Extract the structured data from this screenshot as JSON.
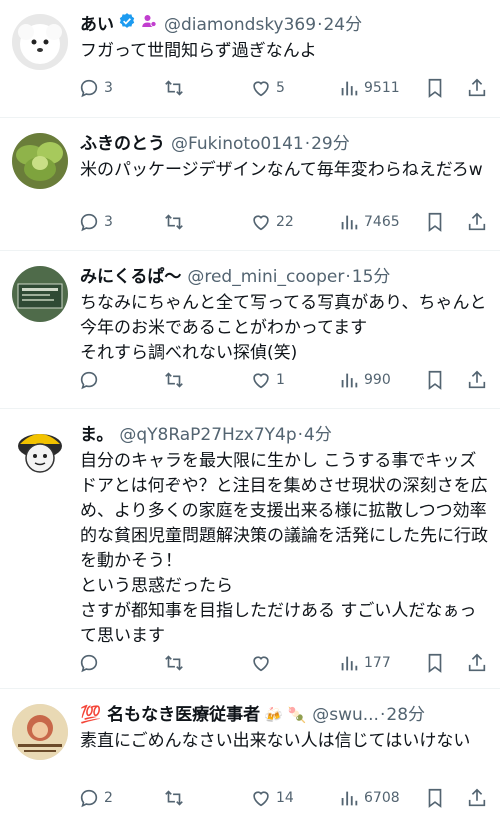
{
  "tweets": [
    {
      "name": "あい",
      "handle": "@diamondsky369",
      "time": "24分",
      "text": "フガって世間知らず過ぎなんよ",
      "replies": "3",
      "retweets": "",
      "likes": "5",
      "views": "9511",
      "avatar_icon": "white-dog-avatar",
      "badges": [
        "verified-check-icon",
        "affiliate-person-icon"
      ]
    },
    {
      "name": "ふきのとう",
      "handle": "@Fukinoto0141",
      "time": "29分",
      "text": "米のパッケージデザインなんて毎年変わらねえだろw",
      "replies": "3",
      "retweets": "",
      "likes": "22",
      "views": "7465",
      "avatar_icon": "green-leaves-avatar"
    },
    {
      "name": "みにくるぱ〜",
      "handle": "@red_mini_cooper",
      "time": "15分",
      "text": "ちなみにちゃんと全て写ってる写真があり、ちゃんと今年のお米であることがわかってます\nそれすら調べれない探偵(笑)",
      "replies": "",
      "retweets": "",
      "likes": "1",
      "views": "990",
      "avatar_icon": "sign-board-avatar"
    },
    {
      "name": "ま。",
      "handle": "@qY8RaP27Hzx7Y4p",
      "time": "4分",
      "text": "自分のキャラを最大限に生かし こうする事でキッズドアとは何ぞや？と注目を集めさせ現状の深刻さを広め、より多くの家庭を支援出来る様に拡散しつつ効率的な貧困児童問題解決策の議論を活発にした先に行政を動かそう！\nという思惑だったら\nさすが都知事を目指しただけある すごい人だなぁって思います",
      "replies": "",
      "retweets": "",
      "likes": "",
      "views": "177",
      "avatar_icon": "cartoon-character-avatar"
    },
    {
      "name": "💯 名もなき医療従事者",
      "handle": "@swu...",
      "time": "28分",
      "text": "素直にごめんなさい出来ない人は信じてはいけない",
      "replies": "2",
      "retweets": "",
      "likes": "14",
      "views": "6708",
      "avatar_icon": "wanted-poster-avatar",
      "name_emoji": "🍻 🍡"
    }
  ],
  "colors": {
    "text_primary": "#0f1419",
    "text_secondary": "#536471",
    "verified": "#1d9bf0",
    "affiliate": "#c13ecf"
  }
}
